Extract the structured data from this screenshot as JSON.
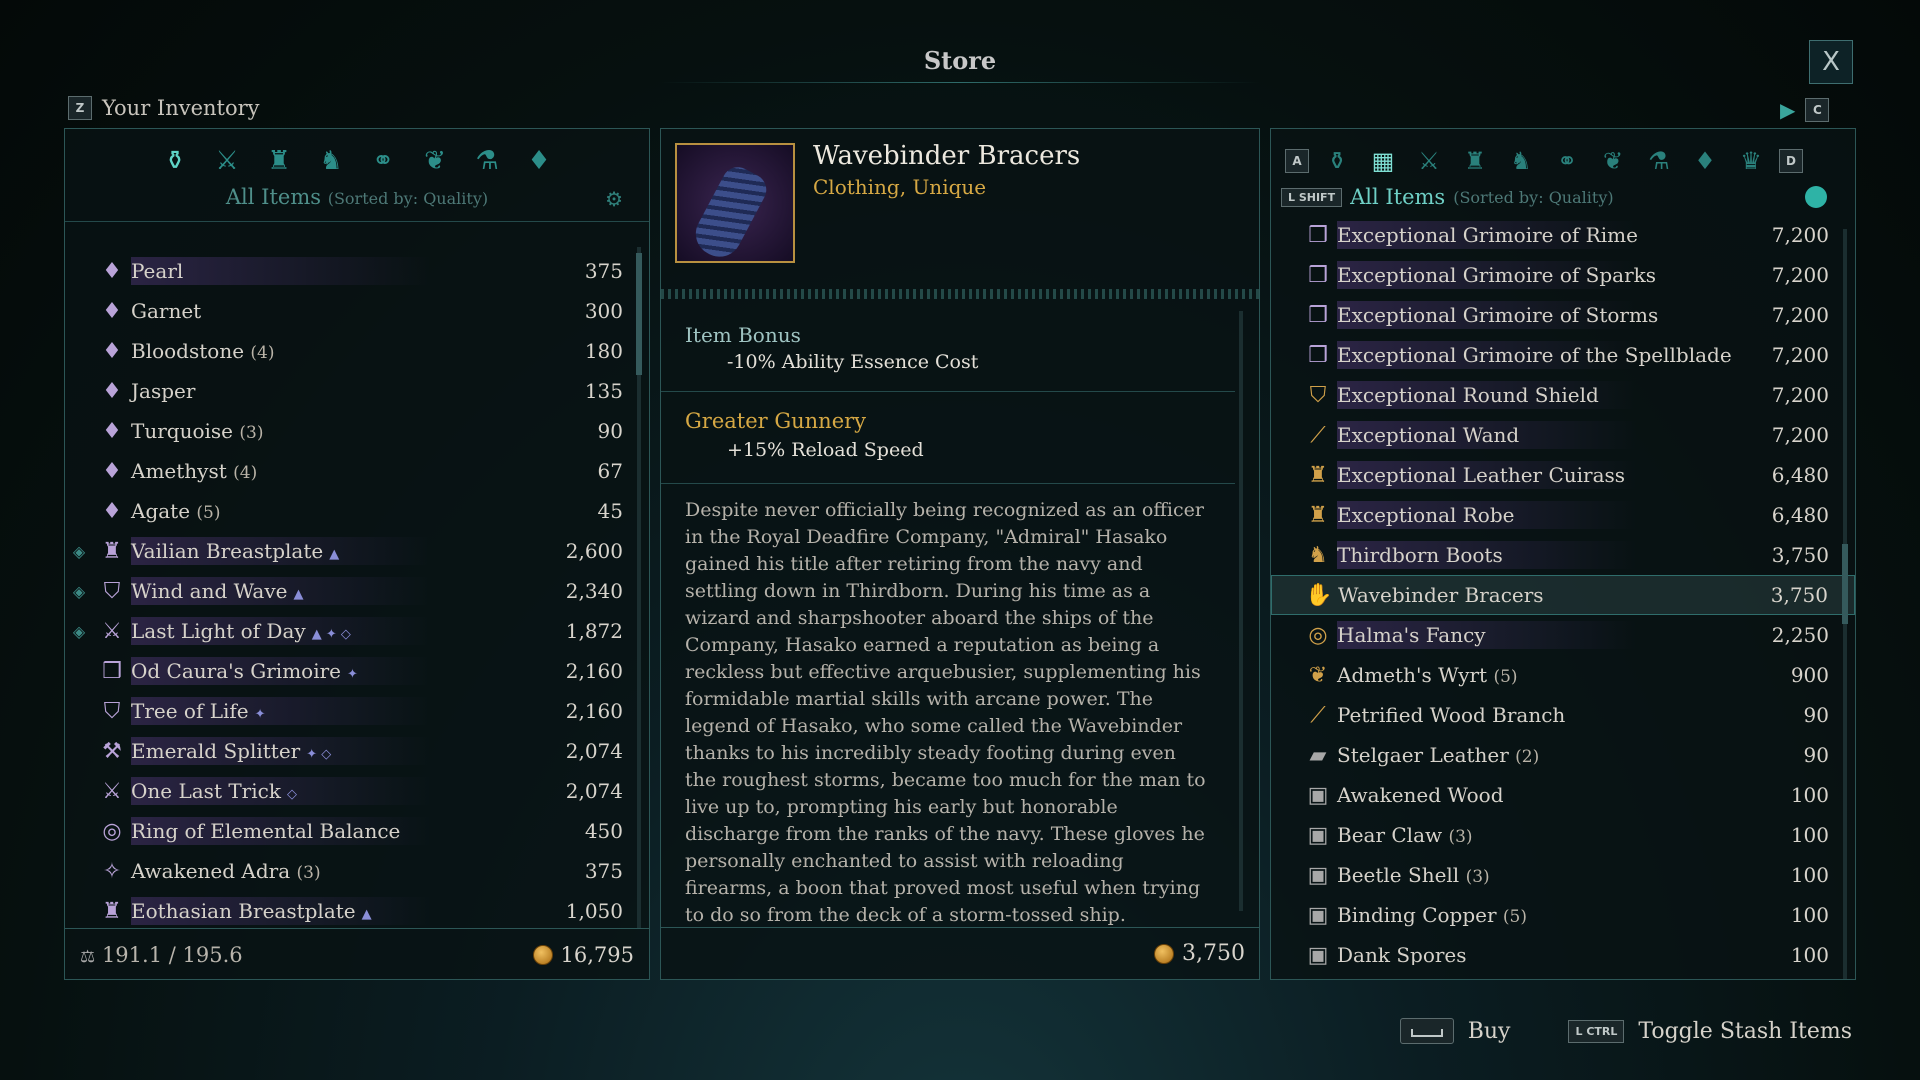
{
  "window": {
    "title": "Store",
    "close_label": "X"
  },
  "inventory": {
    "key": "Z",
    "label": "Your Inventory",
    "category_icons": [
      "all-items-icon",
      "weapons-icon",
      "armor-icon",
      "clothing-icon",
      "accessories-icon",
      "consumables-icon",
      "ingredients-icon",
      "gems-icon"
    ],
    "filter_label": "All Items",
    "sort_label": "(Sorted by: Quality)",
    "items": [
      {
        "name": "Pearl",
        "count": "",
        "value": "375",
        "icon": "gem-icon",
        "glyph": "♦",
        "fav": false,
        "hl": true
      },
      {
        "name": "Garnet",
        "count": "",
        "value": "300",
        "icon": "gem-icon",
        "glyph": "♦",
        "fav": false,
        "hl": false
      },
      {
        "name": "Bloodstone",
        "count": "(4)",
        "value": "180",
        "icon": "gem-icon",
        "glyph": "♦",
        "fav": false,
        "hl": false
      },
      {
        "name": "Jasper",
        "count": "",
        "value": "135",
        "icon": "gem-icon",
        "glyph": "♦",
        "fav": false,
        "hl": false
      },
      {
        "name": "Turquoise",
        "count": "(3)",
        "value": "90",
        "icon": "gem-icon",
        "glyph": "♦",
        "fav": false,
        "hl": false
      },
      {
        "name": "Amethyst",
        "count": "(4)",
        "value": "67",
        "icon": "gem-icon",
        "glyph": "♦",
        "fav": false,
        "hl": false
      },
      {
        "name": "Agate",
        "count": "(5)",
        "value": "45",
        "icon": "gem-icon",
        "glyph": "♦",
        "fav": false,
        "hl": false
      },
      {
        "name": "Vailian Breastplate",
        "count": "",
        "value": "2,600",
        "icon": "breastplate-icon",
        "glyph": "♜",
        "fav": true,
        "hl": true,
        "tag": "▲"
      },
      {
        "name": "Wind and Wave",
        "count": "",
        "value": "2,340",
        "icon": "shield-icon",
        "glyph": "⛉",
        "fav": true,
        "hl": true,
        "tag": "▲"
      },
      {
        "name": "Last Light of Day",
        "count": "",
        "value": "1,872",
        "icon": "sword-icon",
        "glyph": "⚔",
        "fav": true,
        "hl": true,
        "tag": "▲ ✦ ◇"
      },
      {
        "name": "Od Caura's Grimoire",
        "count": "",
        "value": "2,160",
        "icon": "grimoire-icon",
        "glyph": "❒",
        "fav": false,
        "hl": true,
        "tag": "✦"
      },
      {
        "name": "Tree of Life",
        "count": "",
        "value": "2,160",
        "icon": "shield-icon",
        "glyph": "⛉",
        "fav": false,
        "hl": true,
        "tag": "✦"
      },
      {
        "name": "Emerald Splitter",
        "count": "",
        "value": "2,074",
        "icon": "axe-icon",
        "glyph": "⚒",
        "fav": false,
        "hl": true,
        "tag": "✦ ◇"
      },
      {
        "name": "One Last Trick",
        "count": "",
        "value": "2,074",
        "icon": "dagger-icon",
        "glyph": "⚔",
        "fav": false,
        "hl": true,
        "tag": "◇"
      },
      {
        "name": "Ring of Elemental Balance",
        "count": "",
        "value": "450",
        "icon": "ring-icon",
        "glyph": "◎",
        "fav": false,
        "hl": true
      },
      {
        "name": "Awakened Adra",
        "count": "(3)",
        "value": "375",
        "icon": "adra-icon",
        "glyph": "✧",
        "fav": false,
        "hl": false
      },
      {
        "name": "Eothasian Breastplate",
        "count": "",
        "value": "1,050",
        "icon": "breastplate-icon",
        "glyph": "♜",
        "fav": false,
        "hl": true,
        "tag": "▲"
      }
    ],
    "weight": "191.1 / 195.6",
    "money": "16,795"
  },
  "detail": {
    "name": "Wavebinder Bracers",
    "subtitle": "Clothing, Unique",
    "bonus1_title": "Item Bonus",
    "bonus1_line": "-10% Ability Essence Cost",
    "bonus2_title": "Greater Gunnery",
    "bonus2_line": "+15% Reload Speed",
    "lore": "Despite never officially being recognized as an officer in the Royal Deadfire Company, \"Admiral\" Hasako gained his title after retiring from the navy and settling down in Thirdborn. During his time as a wizard and sharpshooter aboard the ships of the Company, Hasako earned a reputation as being a reckless but effective arquebusier, supplementing his formidable martial skills with arcane power. The legend of Hasako, who some called the Wavebinder thanks to his incredibly steady footing during even the roughest storms, became too much for the man to live up to, prompting his early but honorable discharge from the ranks of the navy. These gloves he personally enchanted to assist with reloading firearms, a boon that proved most useful when trying to do so from the deck of a storm-tossed ship.",
    "price": "3,750"
  },
  "store": {
    "key_left": "A",
    "key_right": "D",
    "key_next": "C",
    "shift_key": "L SHIFT",
    "filter_label": "All Items",
    "sort_label": "(Sorted by: Quality)",
    "items": [
      {
        "name": "Exceptional Grimoire of Rime",
        "count": "",
        "value": "7,200",
        "icon": "grimoire-icon",
        "glyph": "❒",
        "hl": true,
        "cls": ""
      },
      {
        "name": "Exceptional Grimoire of Sparks",
        "count": "",
        "value": "7,200",
        "icon": "grimoire-icon",
        "glyph": "❒",
        "hl": true,
        "cls": ""
      },
      {
        "name": "Exceptional Grimoire of Storms",
        "count": "",
        "value": "7,200",
        "icon": "grimoire-icon",
        "glyph": "❒",
        "hl": true,
        "cls": ""
      },
      {
        "name": "Exceptional Grimoire of the Spellblade",
        "count": "",
        "value": "7,200",
        "icon": "grimoire-icon",
        "glyph": "❒",
        "hl": true,
        "cls": ""
      },
      {
        "name": "Exceptional Round Shield",
        "count": "",
        "value": "7,200",
        "icon": "shield-icon",
        "glyph": "⛉",
        "hl": true,
        "cls": "gold"
      },
      {
        "name": "Exceptional Wand",
        "count": "",
        "value": "7,200",
        "icon": "wand-icon",
        "glyph": "⟋",
        "hl": true,
        "cls": "gold"
      },
      {
        "name": "Exceptional Leather Cuirass",
        "count": "",
        "value": "6,480",
        "icon": "armor-icon",
        "glyph": "♜",
        "hl": true,
        "cls": "gold"
      },
      {
        "name": "Exceptional Robe",
        "count": "",
        "value": "6,480",
        "icon": "robe-icon",
        "glyph": "♜",
        "hl": true,
        "cls": "gold"
      },
      {
        "name": "Thirdborn Boots",
        "count": "",
        "value": "3,750",
        "icon": "boots-icon",
        "glyph": "♞",
        "hl": true,
        "cls": "gold"
      },
      {
        "name": "Wavebinder Bracers",
        "count": "",
        "value": "3,750",
        "icon": "bracers-icon",
        "glyph": "✋",
        "hl": false,
        "cls": "gold",
        "sel": true
      },
      {
        "name": "Halma's Fancy",
        "count": "",
        "value": "2,250",
        "icon": "ring-icon",
        "glyph": "◎",
        "hl": true,
        "cls": "gold"
      },
      {
        "name": "Admeth's Wyrt",
        "count": "(5)",
        "value": "900",
        "icon": "herb-icon",
        "glyph": "❦",
        "hl": false,
        "cls": "gold"
      },
      {
        "name": "Petrified Wood Branch",
        "count": "",
        "value": "90",
        "icon": "branch-icon",
        "glyph": "⟋",
        "hl": false,
        "cls": "gold"
      },
      {
        "name": "Stelgaer Leather",
        "count": "(2)",
        "value": "90",
        "icon": "leather-icon",
        "glyph": "▰",
        "hl": false,
        "cls": "gray"
      },
      {
        "name": "Awakened Wood",
        "count": "",
        "value": "100",
        "icon": "ingredient-icon",
        "glyph": "▣",
        "hl": false,
        "cls": "gray"
      },
      {
        "name": "Bear Claw",
        "count": "(3)",
        "value": "100",
        "icon": "ingredient-icon",
        "glyph": "▣",
        "hl": false,
        "cls": "gray"
      },
      {
        "name": "Beetle Shell",
        "count": "(3)",
        "value": "100",
        "icon": "ingredient-icon",
        "glyph": "▣",
        "hl": false,
        "cls": "gray"
      },
      {
        "name": "Binding Copper",
        "count": "(5)",
        "value": "100",
        "icon": "ingredient-icon",
        "glyph": "▣",
        "hl": false,
        "cls": "gray"
      },
      {
        "name": "Dank Spores",
        "count": "",
        "value": "100",
        "icon": "ingredient-icon",
        "glyph": "▣",
        "hl": false,
        "cls": "gray"
      }
    ]
  },
  "hints": {
    "buy_label": "Buy",
    "ctrl_key": "L CTRL",
    "toggle_label": "Toggle Stash Items"
  }
}
